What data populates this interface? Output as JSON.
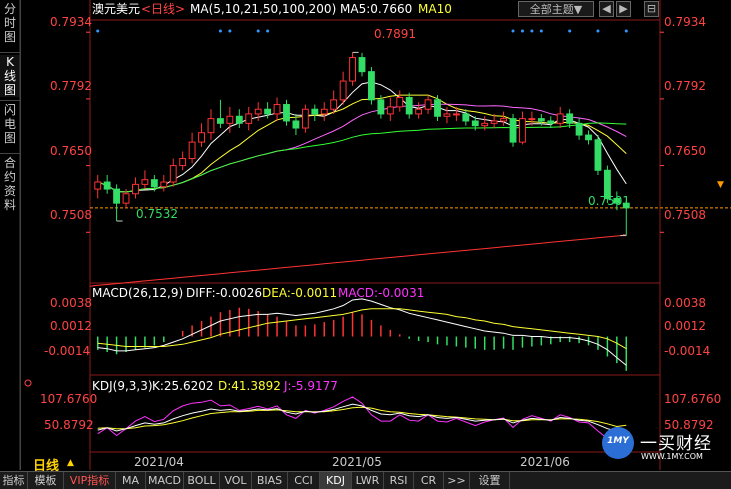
{
  "sidebar": {
    "tabs": [
      {
        "label": "分时图",
        "active": false
      },
      {
        "label": "K线图",
        "active": true
      },
      {
        "label": "闪电图",
        "active": false
      },
      {
        "label": "合约资料",
        "active": false
      }
    ]
  },
  "header": {
    "title": "澳元美元",
    "period_tag": "<日线>",
    "ma_label": "MA(5,10,21,50,100,200)",
    "ma5_label": "MA5:0.7660",
    "ma10_label": "MA10",
    "theme_button": "全部主题▼",
    "prev_icon": "◀",
    "next_icon": "▶",
    "collapse_icon": "⊟"
  },
  "macd": {
    "label": "MACD(26,12,9)",
    "diff_label": "DIFF:-0.0026",
    "dea_label": "DEA:-0.0011",
    "macd_label": "MACD:-0.0031",
    "ticks": [
      "0.0038",
      "0.0012",
      "-0.0014"
    ]
  },
  "kdj": {
    "label": "KDJ(9,3,3)",
    "k_label": "K:25.6202",
    "d_label": "D:41.3892",
    "j_label": "J:-5.9177",
    "ticks": [
      "107.6760",
      "50.8792"
    ]
  },
  "annotations": {
    "high": "0.7891",
    "low_left": "0.7532",
    "low_right": "0.7501"
  },
  "x_labels": [
    "2021/04",
    "2021/05",
    "2021/06"
  ],
  "footer": {
    "period": "日线",
    "period_arrow": "▲",
    "tabs": [
      "指标",
      "模板",
      "VIP指标",
      "MA",
      "MACD",
      "BOLL",
      "VOL",
      "BIAS",
      "CCI",
      "KDJ",
      "LWR",
      "RSI",
      "CR",
      ">>",
      "设置"
    ],
    "active_tab": "KDJ"
  },
  "logo": {
    "badge": "1MY",
    "name": "一买财经",
    "url": "WWW.1MY.COM"
  },
  "colors": {
    "up": "#ff3333",
    "down": "#33dd66",
    "axis_text": "#ff4444",
    "grid": "#8b1a1a",
    "ma5": "#ffffff",
    "ma10": "#ffff33",
    "ma21": "#ff66ff",
    "ma50": "#33ff33",
    "ma200": "#ff3333",
    "diff": "#ffffff",
    "dea": "#ffff33",
    "k": "#ffffff",
    "d": "#ffff33",
    "j": "#ff33ff"
  },
  "chart_data": [
    {
      "type": "candlestick",
      "title": "澳元美元<日线>",
      "y_ticks": [
        "0.7934",
        "0.7792",
        "0.7650",
        "0.7508"
      ],
      "ylim": [
        0.74,
        0.796
      ],
      "last_price": 0.756,
      "x": [
        "04-01",
        "04-02",
        "04-05",
        "04-06",
        "04-07",
        "04-08",
        "04-09",
        "04-12",
        "04-13",
        "04-14",
        "04-15",
        "04-16",
        "04-19",
        "04-20",
        "04-21",
        "04-22",
        "04-23",
        "04-26",
        "04-27",
        "04-28",
        "04-29",
        "04-30",
        "05-03",
        "05-04",
        "05-05",
        "05-06",
        "05-07",
        "05-10",
        "05-11",
        "05-12",
        "05-13",
        "05-14",
        "05-17",
        "05-18",
        "05-19",
        "05-20",
        "05-21",
        "05-24",
        "05-25",
        "05-26",
        "05-27",
        "05-28",
        "05-31",
        "06-01",
        "06-02",
        "06-03",
        "06-04",
        "06-07",
        "06-08",
        "06-09",
        "06-10",
        "06-11",
        "06-14",
        "06-15",
        "06-16",
        "06-17",
        "06-18"
      ],
      "open": [
        0.76,
        0.7615,
        0.76,
        0.757,
        0.759,
        0.761,
        0.762,
        0.7605,
        0.7615,
        0.765,
        0.7665,
        0.77,
        0.772,
        0.775,
        0.774,
        0.7755,
        0.774,
        0.776,
        0.777,
        0.776,
        0.778,
        0.7745,
        0.773,
        0.777,
        0.776,
        0.777,
        0.779,
        0.783,
        0.788,
        0.785,
        0.779,
        0.776,
        0.7775,
        0.7795,
        0.776,
        0.777,
        0.779,
        0.7755,
        0.776,
        0.776,
        0.7745,
        0.7735,
        0.774,
        0.7745,
        0.775,
        0.77,
        0.775,
        0.775,
        0.7745,
        0.774,
        0.776,
        0.774,
        0.7715,
        0.7705,
        0.764,
        0.758,
        0.757
      ],
      "close": [
        0.7615,
        0.76,
        0.757,
        0.759,
        0.761,
        0.762,
        0.7605,
        0.7615,
        0.765,
        0.7665,
        0.77,
        0.772,
        0.775,
        0.774,
        0.7755,
        0.774,
        0.776,
        0.777,
        0.776,
        0.778,
        0.7745,
        0.773,
        0.777,
        0.776,
        0.777,
        0.779,
        0.783,
        0.788,
        0.785,
        0.779,
        0.776,
        0.7775,
        0.7795,
        0.776,
        0.777,
        0.779,
        0.7755,
        0.776,
        0.776,
        0.7745,
        0.7735,
        0.774,
        0.7745,
        0.775,
        0.77,
        0.775,
        0.775,
        0.7745,
        0.774,
        0.776,
        0.774,
        0.7715,
        0.7705,
        0.764,
        0.758,
        0.757,
        0.756
      ],
      "high": [
        0.763,
        0.763,
        0.761,
        0.76,
        0.7625,
        0.764,
        0.763,
        0.763,
        0.7665,
        0.768,
        0.772,
        0.774,
        0.777,
        0.779,
        0.7775,
        0.777,
        0.7775,
        0.7785,
        0.7785,
        0.7795,
        0.779,
        0.776,
        0.778,
        0.778,
        0.7785,
        0.781,
        0.785,
        0.7891,
        0.789,
        0.786,
        0.78,
        0.7795,
        0.781,
        0.7805,
        0.7785,
        0.78,
        0.78,
        0.7775,
        0.7775,
        0.777,
        0.7755,
        0.7755,
        0.776,
        0.7765,
        0.776,
        0.7765,
        0.7765,
        0.776,
        0.7755,
        0.7775,
        0.777,
        0.775,
        0.7725,
        0.7715,
        0.765,
        0.7595,
        0.7575
      ],
      "low": [
        0.758,
        0.759,
        0.7532,
        0.756,
        0.758,
        0.76,
        0.7595,
        0.7595,
        0.7605,
        0.764,
        0.7655,
        0.769,
        0.7705,
        0.773,
        0.772,
        0.773,
        0.7725,
        0.7745,
        0.775,
        0.7745,
        0.7735,
        0.7715,
        0.772,
        0.7745,
        0.7745,
        0.776,
        0.778,
        0.782,
        0.784,
        0.778,
        0.775,
        0.7745,
        0.7765,
        0.775,
        0.775,
        0.776,
        0.7745,
        0.774,
        0.7745,
        0.7735,
        0.7725,
        0.7725,
        0.773,
        0.7735,
        0.769,
        0.7695,
        0.7735,
        0.7735,
        0.773,
        0.773,
        0.773,
        0.7705,
        0.7695,
        0.763,
        0.757,
        0.7555,
        0.7501
      ]
    },
    {
      "type": "bar",
      "title": "MACD(26,12,9)",
      "ylim": [
        -0.0032,
        0.0042
      ],
      "macd_hist": [
        -0.0012,
        -0.0014,
        -0.0016,
        -0.0014,
        -0.0012,
        -0.001,
        -0.0008,
        -0.0005,
        0.0,
        0.0005,
        0.001,
        0.0014,
        0.0018,
        0.0022,
        0.0024,
        0.0026,
        0.0025,
        0.0023,
        0.002,
        0.0018,
        0.0014,
        0.001,
        0.001,
        0.0011,
        0.0013,
        0.0015,
        0.0018,
        0.0022,
        0.002,
        0.0015,
        0.001,
        0.0006,
        0.0002,
        -0.0002,
        -0.0004,
        -0.0005,
        -0.0007,
        -0.0008,
        -0.0009,
        -0.001,
        -0.0011,
        -0.0012,
        -0.0012,
        -0.0011,
        -0.0012,
        -0.001,
        -0.0009,
        -0.0008,
        -0.0007,
        -0.0005,
        -0.0005,
        -0.0006,
        -0.0008,
        -0.0012,
        -0.0018,
        -0.0024,
        -0.0031
      ],
      "diff": [
        -0.001,
        -0.0011,
        -0.0013,
        -0.0013,
        -0.0012,
        -0.0011,
        -0.001,
        -0.0008,
        -0.0005,
        -0.0002,
        0.0002,
        0.0006,
        0.001,
        0.0014,
        0.0016,
        0.0018,
        0.0019,
        0.002,
        0.002,
        0.0021,
        0.002,
        0.0019,
        0.002,
        0.0021,
        0.0023,
        0.0025,
        0.0028,
        0.0033,
        0.0034,
        0.0032,
        0.0029,
        0.0026,
        0.0024,
        0.0021,
        0.0019,
        0.0017,
        0.0015,
        0.0013,
        0.0011,
        0.0009,
        0.0007,
        0.0005,
        0.0004,
        0.0003,
        0.0001,
        0.0001,
        0.0,
        0.0,
        -0.0001,
        -0.0001,
        -0.0001,
        -0.0002,
        -0.0004,
        -0.0007,
        -0.0012,
        -0.0019,
        -0.0026
      ],
      "dea": [
        -0.0006,
        -0.0007,
        -0.0008,
        -0.0009,
        -0.0009,
        -0.0009,
        -0.0009,
        -0.0009,
        -0.0008,
        -0.0007,
        -0.0005,
        -0.0003,
        -0.0001,
        0.0002,
        0.0004,
        0.0006,
        0.0008,
        0.001,
        0.0012,
        0.0013,
        0.0014,
        0.0015,
        0.0016,
        0.0017,
        0.0018,
        0.0019,
        0.002,
        0.0022,
        0.0024,
        0.0025,
        0.0025,
        0.0025,
        0.0025,
        0.0024,
        0.0023,
        0.0022,
        0.0021,
        0.002,
        0.0018,
        0.0017,
        0.0015,
        0.0014,
        0.0012,
        0.0011,
        0.0009,
        0.0008,
        0.0007,
        0.0006,
        0.0005,
        0.0004,
        0.0003,
        0.0002,
        0.0001,
        0.0,
        -0.0002,
        -0.0006,
        -0.0011
      ]
    },
    {
      "type": "line",
      "title": "KDJ(9,3,3)",
      "ylim": [
        -10,
        115
      ],
      "k": [
        30,
        35,
        28,
        33,
        40,
        46,
        43,
        46,
        55,
        62,
        68,
        72,
        77,
        74,
        76,
        72,
        74,
        77,
        75,
        78,
        70,
        66,
        72,
        70,
        72,
        76,
        82,
        88,
        84,
        74,
        66,
        64,
        68,
        62,
        60,
        64,
        58,
        56,
        58,
        54,
        50,
        52,
        53,
        55,
        46,
        52,
        56,
        54,
        52,
        58,
        56,
        52,
        50,
        42,
        33,
        28,
        26
      ],
      "d": [
        34,
        35,
        33,
        33,
        35,
        39,
        40,
        42,
        46,
        51,
        57,
        62,
        67,
        69,
        71,
        71,
        72,
        74,
        74,
        75,
        73,
        71,
        71,
        71,
        71,
        73,
        76,
        80,
        81,
        79,
        74,
        71,
        70,
        67,
        65,
        64,
        62,
        60,
        59,
        57,
        55,
        54,
        53,
        54,
        51,
        51,
        53,
        53,
        53,
        55,
        55,
        54,
        52,
        49,
        44,
        38,
        41
      ],
      "j": [
        22,
        35,
        18,
        33,
        50,
        60,
        49,
        54,
        73,
        84,
        90,
        92,
        97,
        84,
        86,
        74,
        78,
        83,
        77,
        84,
        64,
        56,
        74,
        68,
        74,
        82,
        94,
        104,
        90,
        64,
        50,
        50,
        64,
        52,
        50,
        64,
        50,
        48,
        56,
        48,
        40,
        48,
        53,
        57,
        36,
        54,
        62,
        56,
        50,
        64,
        58,
        48,
        46,
        28,
        11,
        8,
        -5.9
      ]
    }
  ]
}
